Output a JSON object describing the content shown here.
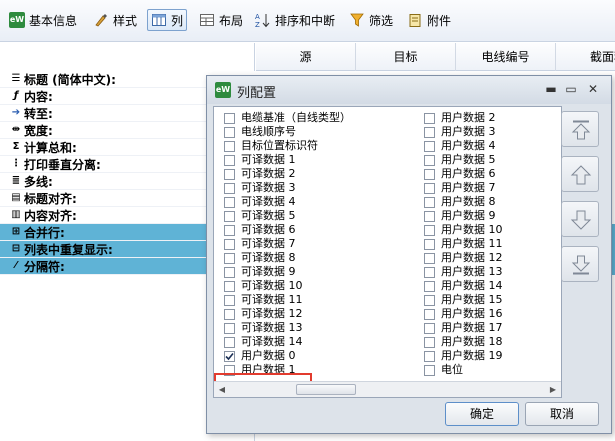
{
  "toolbar": {
    "tabs": [
      {
        "label": "基本信息",
        "icon": "ew-logo-icon"
      },
      {
        "label": "样式",
        "icon": "style-icon"
      },
      {
        "label": "列",
        "icon": "columns-icon",
        "active": true
      },
      {
        "label": "布局",
        "icon": "layout-icon"
      },
      {
        "label": "排序和中断",
        "icon": "sort-icon"
      },
      {
        "label": "筛选",
        "icon": "filter-icon"
      },
      {
        "label": "附件",
        "icon": "attachment-icon"
      }
    ]
  },
  "properties": [
    {
      "label": "标题 (简体中文):",
      "icon": "title-icon"
    },
    {
      "label": "内容:",
      "icon": "fx-icon"
    },
    {
      "label": "转至:",
      "icon": "goto-icon"
    },
    {
      "label": "宽度:",
      "icon": "width-icon"
    },
    {
      "label": "计算总和:",
      "icon": "sigma-icon"
    },
    {
      "label": "打印垂直分离:",
      "icon": "print-sep-icon"
    },
    {
      "label": "多线:",
      "icon": "multiline-icon"
    },
    {
      "label": "标题对齐:",
      "icon": "title-align-icon"
    },
    {
      "label": "内容对齐:",
      "icon": "content-align-icon"
    },
    {
      "label": "合并行:",
      "icon": "merge-rows-icon",
      "selected": true
    },
    {
      "label": "列表中重复显示:",
      "icon": "repeat-icon",
      "selected": true
    },
    {
      "label": "分隔符:",
      "icon": "separator-icon",
      "selected": true
    }
  ],
  "grid": {
    "columns": [
      "源",
      "目标",
      "电线编号",
      "截面积"
    ]
  },
  "dialog": {
    "title": "列配置",
    "left_items": [
      {
        "label": "电缆基准（自线类型）",
        "checked": false
      },
      {
        "label": "电线顺序号",
        "checked": false
      },
      {
        "label": "目标位置标识符",
        "checked": false
      },
      {
        "label": "可译数据 1",
        "checked": false
      },
      {
        "label": "可译数据 2",
        "checked": false
      },
      {
        "label": "可译数据 3",
        "checked": false
      },
      {
        "label": "可译数据 4",
        "checked": false
      },
      {
        "label": "可译数据 5",
        "checked": false
      },
      {
        "label": "可译数据 6",
        "checked": false
      },
      {
        "label": "可译数据 7",
        "checked": false
      },
      {
        "label": "可译数据 8",
        "checked": false
      },
      {
        "label": "可译数据 9",
        "checked": false
      },
      {
        "label": "可译数据 10",
        "checked": false
      },
      {
        "label": "可译数据 11",
        "checked": false
      },
      {
        "label": "可译数据 12",
        "checked": false
      },
      {
        "label": "可译数据 13",
        "checked": false
      },
      {
        "label": "可译数据 14",
        "checked": false
      },
      {
        "label": "用户数据 0",
        "checked": true
      },
      {
        "label": "用户数据 1",
        "checked": false
      }
    ],
    "right_items": [
      {
        "label": "用户数据 2",
        "checked": false
      },
      {
        "label": "用户数据 3",
        "checked": false
      },
      {
        "label": "用户数据 4",
        "checked": false
      },
      {
        "label": "用户数据 5",
        "checked": false
      },
      {
        "label": "用户数据 6",
        "checked": false
      },
      {
        "label": "用户数据 7",
        "checked": false
      },
      {
        "label": "用户数据 8",
        "checked": false
      },
      {
        "label": "用户数据 9",
        "checked": false
      },
      {
        "label": "用户数据 10",
        "checked": false
      },
      {
        "label": "用户数据 11",
        "checked": false
      },
      {
        "label": "用户数据 12",
        "checked": false
      },
      {
        "label": "用户数据 13",
        "checked": false
      },
      {
        "label": "用户数据 14",
        "checked": false
      },
      {
        "label": "用户数据 15",
        "checked": false
      },
      {
        "label": "用户数据 16",
        "checked": false
      },
      {
        "label": "用户数据 17",
        "checked": false
      },
      {
        "label": "用户数据 18",
        "checked": false
      },
      {
        "label": "用户数据 19",
        "checked": false
      },
      {
        "label": "电位",
        "checked": false
      }
    ],
    "ok_label": "确定",
    "cancel_label": "取消"
  },
  "colors": {
    "selection": "#5fb3d6",
    "highlight": "#e23b2e",
    "logo": "#2e8b3e"
  }
}
